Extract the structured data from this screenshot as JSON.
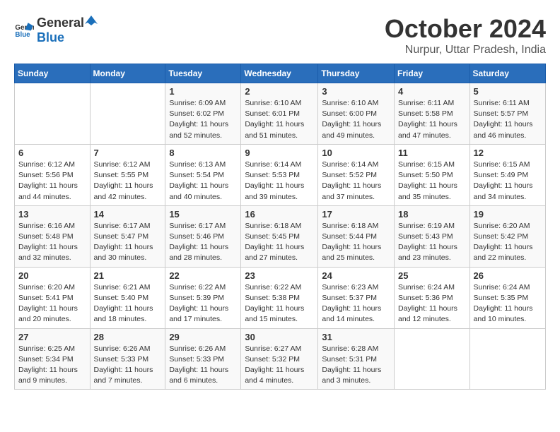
{
  "logo": {
    "general": "General",
    "blue": "Blue"
  },
  "title": "October 2024",
  "subtitle": "Nurpur, Uttar Pradesh, India",
  "headers": [
    "Sunday",
    "Monday",
    "Tuesday",
    "Wednesday",
    "Thursday",
    "Friday",
    "Saturday"
  ],
  "weeks": [
    [
      {
        "day": "",
        "info": ""
      },
      {
        "day": "",
        "info": ""
      },
      {
        "day": "1",
        "info": "Sunrise: 6:09 AM\nSunset: 6:02 PM\nDaylight: 11 hours and 52 minutes."
      },
      {
        "day": "2",
        "info": "Sunrise: 6:10 AM\nSunset: 6:01 PM\nDaylight: 11 hours and 51 minutes."
      },
      {
        "day": "3",
        "info": "Sunrise: 6:10 AM\nSunset: 6:00 PM\nDaylight: 11 hours and 49 minutes."
      },
      {
        "day": "4",
        "info": "Sunrise: 6:11 AM\nSunset: 5:58 PM\nDaylight: 11 hours and 47 minutes."
      },
      {
        "day": "5",
        "info": "Sunrise: 6:11 AM\nSunset: 5:57 PM\nDaylight: 11 hours and 46 minutes."
      }
    ],
    [
      {
        "day": "6",
        "info": "Sunrise: 6:12 AM\nSunset: 5:56 PM\nDaylight: 11 hours and 44 minutes."
      },
      {
        "day": "7",
        "info": "Sunrise: 6:12 AM\nSunset: 5:55 PM\nDaylight: 11 hours and 42 minutes."
      },
      {
        "day": "8",
        "info": "Sunrise: 6:13 AM\nSunset: 5:54 PM\nDaylight: 11 hours and 40 minutes."
      },
      {
        "day": "9",
        "info": "Sunrise: 6:14 AM\nSunset: 5:53 PM\nDaylight: 11 hours and 39 minutes."
      },
      {
        "day": "10",
        "info": "Sunrise: 6:14 AM\nSunset: 5:52 PM\nDaylight: 11 hours and 37 minutes."
      },
      {
        "day": "11",
        "info": "Sunrise: 6:15 AM\nSunset: 5:50 PM\nDaylight: 11 hours and 35 minutes."
      },
      {
        "day": "12",
        "info": "Sunrise: 6:15 AM\nSunset: 5:49 PM\nDaylight: 11 hours and 34 minutes."
      }
    ],
    [
      {
        "day": "13",
        "info": "Sunrise: 6:16 AM\nSunset: 5:48 PM\nDaylight: 11 hours and 32 minutes."
      },
      {
        "day": "14",
        "info": "Sunrise: 6:17 AM\nSunset: 5:47 PM\nDaylight: 11 hours and 30 minutes."
      },
      {
        "day": "15",
        "info": "Sunrise: 6:17 AM\nSunset: 5:46 PM\nDaylight: 11 hours and 28 minutes."
      },
      {
        "day": "16",
        "info": "Sunrise: 6:18 AM\nSunset: 5:45 PM\nDaylight: 11 hours and 27 minutes."
      },
      {
        "day": "17",
        "info": "Sunrise: 6:18 AM\nSunset: 5:44 PM\nDaylight: 11 hours and 25 minutes."
      },
      {
        "day": "18",
        "info": "Sunrise: 6:19 AM\nSunset: 5:43 PM\nDaylight: 11 hours and 23 minutes."
      },
      {
        "day": "19",
        "info": "Sunrise: 6:20 AM\nSunset: 5:42 PM\nDaylight: 11 hours and 22 minutes."
      }
    ],
    [
      {
        "day": "20",
        "info": "Sunrise: 6:20 AM\nSunset: 5:41 PM\nDaylight: 11 hours and 20 minutes."
      },
      {
        "day": "21",
        "info": "Sunrise: 6:21 AM\nSunset: 5:40 PM\nDaylight: 11 hours and 18 minutes."
      },
      {
        "day": "22",
        "info": "Sunrise: 6:22 AM\nSunset: 5:39 PM\nDaylight: 11 hours and 17 minutes."
      },
      {
        "day": "23",
        "info": "Sunrise: 6:22 AM\nSunset: 5:38 PM\nDaylight: 11 hours and 15 minutes."
      },
      {
        "day": "24",
        "info": "Sunrise: 6:23 AM\nSunset: 5:37 PM\nDaylight: 11 hours and 14 minutes."
      },
      {
        "day": "25",
        "info": "Sunrise: 6:24 AM\nSunset: 5:36 PM\nDaylight: 11 hours and 12 minutes."
      },
      {
        "day": "26",
        "info": "Sunrise: 6:24 AM\nSunset: 5:35 PM\nDaylight: 11 hours and 10 minutes."
      }
    ],
    [
      {
        "day": "27",
        "info": "Sunrise: 6:25 AM\nSunset: 5:34 PM\nDaylight: 11 hours and 9 minutes."
      },
      {
        "day": "28",
        "info": "Sunrise: 6:26 AM\nSunset: 5:33 PM\nDaylight: 11 hours and 7 minutes."
      },
      {
        "day": "29",
        "info": "Sunrise: 6:26 AM\nSunset: 5:33 PM\nDaylight: 11 hours and 6 minutes."
      },
      {
        "day": "30",
        "info": "Sunrise: 6:27 AM\nSunset: 5:32 PM\nDaylight: 11 hours and 4 minutes."
      },
      {
        "day": "31",
        "info": "Sunrise: 6:28 AM\nSunset: 5:31 PM\nDaylight: 11 hours and 3 minutes."
      },
      {
        "day": "",
        "info": ""
      },
      {
        "day": "",
        "info": ""
      }
    ]
  ]
}
